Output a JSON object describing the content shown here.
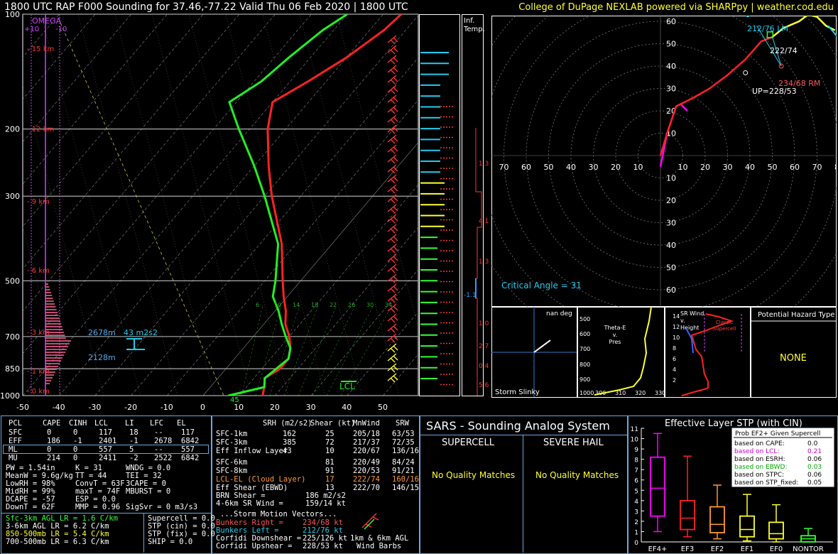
{
  "header": {
    "title": "1800 UTC RAP F000 Sounding for 37.46,-77.22 Valid  Thu 06 Feb 2020 | 1800 UTC",
    "credit": "College of DuPage NEXLAB powered via SHARPpy | weather.cod.edu"
  },
  "skewt": {
    "pressure_labels": [
      "100",
      "200",
      "300",
      "500",
      "700",
      "850",
      "1000"
    ],
    "temp_labels": [
      "-50",
      "-40",
      "-30",
      "-20",
      "-10",
      "0",
      "10",
      "20",
      "30",
      "40",
      "50"
    ],
    "height_labels": [
      "15 km",
      "12 km",
      "9 km",
      "6 km",
      "3 km",
      "1 km",
      "0 km"
    ],
    "omega_label": "OMEGA",
    "omega_plus": "+10",
    "omega_minus": "-10",
    "ann_2678": "2678m",
    "ann_2128": "2128m",
    "ann_srh": "43 m2s2",
    "lcl": "LCL",
    "sfc_td": "45",
    "wetbulb_labels": [
      "6",
      "10",
      "14",
      "18",
      "22",
      "26",
      "30",
      "34"
    ]
  },
  "infl": {
    "title1": "Inf.",
    "title2": "Temp.",
    "values": [
      "1.3",
      "4.1",
      "1.3",
      "-1.1",
      "1.0",
      "2.7",
      "0.4",
      "5.6"
    ]
  },
  "hodo": {
    "x_labels": [
      "70",
      "60",
      "50",
      "40",
      "30",
      "20",
      "10",
      "10",
      "20",
      "30",
      "40",
      "50",
      "60",
      "70",
      "80"
    ],
    "y_labels": [
      "60",
      "50",
      "40",
      "30",
      "20",
      "10",
      "10",
      "20",
      "30",
      "40",
      "50",
      "60"
    ],
    "lm": "212/76 LM",
    "mean": "222/74",
    "rm": "234/68 RM",
    "up": "UP=228/53",
    "critical": "Critical Angle = 31"
  },
  "small": {
    "slinky_title": "nan deg",
    "slinky_label": "Storm Slinky",
    "thetae_title": "Theta-E\nv.\nPres",
    "thetae_y": [
      "500",
      "600",
      "700",
      "800",
      "900",
      "1000"
    ],
    "thetae_x": [
      "300",
      "310",
      "320",
      "330"
    ],
    "srwind_title": "SR Wind\nv.\nHeight",
    "srwind_y": [
      "14",
      "12",
      "10",
      "8",
      "6",
      "4",
      "2"
    ],
    "srwind_classic": "Classic\nSupercell",
    "hazard_title": "Potential Hazard Type",
    "hazard_value": "NONE"
  },
  "parcel_table": {
    "headers": [
      "PCL",
      "CAPE",
      "CINH",
      "LCL",
      "LI",
      "LFC",
      "EL"
    ],
    "rows": [
      [
        "SFC",
        "0",
        "0",
        "117",
        "18",
        "--",
        "117"
      ],
      [
        "EFF",
        "186",
        "-1",
        "2401",
        "-1",
        "2678",
        "6842"
      ],
      [
        "ML",
        "0",
        "0",
        "557",
        "5",
        "--",
        "557"
      ],
      [
        "MU",
        "214",
        "0",
        "2411",
        "-2",
        "2522",
        "6842"
      ]
    ]
  },
  "indices": [
    [
      "PW = 1.54in",
      "K = 31",
      "WNDG = 0.0"
    ],
    [
      "MeanW = 9.6g/kg",
      "TT = 44",
      "TEI = 32"
    ],
    [
      "LowRH = 98%",
      "ConvT = 63F",
      "3CAPE = 0"
    ],
    [
      "MidRH = 99%",
      "maxT = 74F",
      "MBURST = 0"
    ],
    [
      "DCAPE = -57",
      "ESP = 0.0",
      ""
    ],
    [
      "DownT = 62F",
      "MMP = 0.96",
      "SigSvr = 0 m3/s3"
    ]
  ],
  "lapse": [
    {
      "text": "Sfc-3km AGL LR = 1.6 C/km",
      "color": "#33ff33"
    },
    {
      "text": "3-6km AGL LR = 6.2 C/km",
      "color": "#ffffff"
    },
    {
      "text": "850-500mb LR = 5.4 C/km",
      "color": "#ffff33"
    },
    {
      "text": "700-500mb LR = 6.3 C/km",
      "color": "#ffffff"
    }
  ],
  "composite": [
    "Supercell = 0.0",
    "STP (cin) = 0.0",
    "STP (fix) = 0.0",
    "SHIP = 0.0"
  ],
  "kinematics": {
    "headers": [
      "SRH (m2/s2)",
      "Shear (kt)",
      "MnWind",
      "SRW"
    ],
    "rows": [
      {
        "label": "SFC-1km",
        "vals": [
          "162",
          "25",
          "205/18",
          "63/53"
        ],
        "color": "#ffffff"
      },
      {
        "label": "SFC-3km",
        "vals": [
          "385",
          "72",
          "217/37",
          "72/35"
        ],
        "color": "#ffffff"
      },
      {
        "label": "Eff Inflow Layer",
        "vals": [
          "43",
          "10",
          "220/67",
          "136/16"
        ],
        "color": "#ffffff"
      },
      {
        "label": "SFC-6km",
        "vals": [
          "81",
          "220/49",
          "84/24"
        ],
        "color": "#ffffff"
      },
      {
        "label": "SFC-8km",
        "vals": [
          "91",
          "220/53",
          "91/21"
        ],
        "color": "#ffffff"
      },
      {
        "label": "LCL-EL (Cloud Layer)",
        "vals": [
          "17",
          "222/74",
          "160/16"
        ],
        "color": "#ff9933"
      },
      {
        "label": "Eff Shear (EBWD)",
        "vals": [
          "13",
          "222/70",
          "146/15"
        ],
        "color": "#ffffff"
      }
    ],
    "brn_label": "BRN Shear =",
    "brn": "186 m2/s2",
    "sr46_label": "4-6km SR Wind =",
    "sr46": "159/14 kt",
    "smv": "...Storm Motion Vectors...",
    "br_label": "Bunkers Right =",
    "br": "234/68 kt",
    "bl_label": "Bunkers Left =",
    "bl": "212/76 kt",
    "cd_label": "Corfidi Downshear =",
    "cd": "225/126 kt",
    "cu_label": "Corfidi Upshear =",
    "cu": "228/53 kt",
    "barb_label1": "1km & 6km AGL",
    "barb_label2": "Wind Barbs"
  },
  "sars": {
    "title": "SARS - Sounding Analog System",
    "supercell": "SUPERCELL",
    "hail": "SEVERE HAIL",
    "nq1": "No Quality Matches",
    "nq2": "No Quality Matches"
  },
  "stp": {
    "title": "Effective Layer STP (with CIN)",
    "y_labels": [
      "11",
      "10",
      "9",
      "8",
      "7",
      "6",
      "5",
      "4",
      "3",
      "2",
      "1",
      "0"
    ],
    "x_labels": [
      "EF4+",
      "EF3",
      "EF2",
      "EF1",
      "EF0",
      "NONTOR"
    ],
    "prob_title": "Prob EF2+ Given Supercell",
    "prob_rows": [
      {
        "label": "based on CAPE:",
        "val": "0.0",
        "color": "#000000"
      },
      {
        "label": "based on LCL:",
        "val": "0.21",
        "color": "#cc00cc"
      },
      {
        "label": "based on ESRH:",
        "val": "0.06",
        "color": "#000000"
      },
      {
        "label": "based on EBWD:",
        "val": "0.03",
        "color": "#00aa00"
      },
      {
        "label": "based on STPC:",
        "val": "0.06",
        "color": "#000000"
      },
      {
        "label": "based on STP_fixed:",
        "val": "0.05",
        "color": "#000000"
      }
    ]
  },
  "chart_data": [
    {
      "type": "line",
      "title": "",
      "xlabel": "",
      "ylabel": "",
      "xlim": [
        -50,
        50
      ],
      "ylim": [
        1000,
        100
      ],
      "scale": "log-pressure",
      "series": [
        {
          "name": "",
          "color": "#ff2222",
          "points": [
            [
              1000,
              16.5
            ],
            [
              950,
              15
            ],
            [
              900,
              13
            ],
            [
              850,
              15
            ],
            [
              800,
              15
            ],
            [
              750,
              13
            ],
            [
              700,
              10
            ],
            [
              650,
              6
            ],
            [
              600,
              3
            ],
            [
              550,
              -1
            ],
            [
              500,
              -5
            ],
            [
              400,
              -14
            ],
            [
              300,
              -28
            ],
            [
              250,
              -36
            ],
            [
              200,
              -45
            ],
            [
              170,
              -50
            ],
            [
              150,
              -45
            ],
            [
              130,
              -40
            ],
            [
              110,
              -36
            ],
            [
              100,
              -35
            ]
          ]
        },
        {
          "name": "",
          "color": "#22ee22",
          "points": [
            [
              1000,
              7
            ],
            [
              950,
              15
            ],
            [
              900,
              13
            ],
            [
              850,
              14
            ],
            [
              800,
              15
            ],
            [
              750,
              13
            ],
            [
              700,
              9
            ],
            [
              650,
              5
            ],
            [
              600,
              1
            ],
            [
              550,
              -4
            ],
            [
              500,
              -7
            ],
            [
              400,
              -15
            ],
            [
              300,
              -30
            ],
            [
              250,
              -40
            ],
            [
              200,
              -53
            ],
            [
              170,
              -62
            ],
            [
              150,
              -58
            ],
            [
              130,
              -56
            ],
            [
              110,
              -53
            ],
            [
              100,
              -50
            ]
          ]
        }
      ],
      "grid": true
    },
    {
      "type": "line",
      "title": "",
      "xlim": [
        -70,
        80
      ],
      "ylim": [
        -60,
        60
      ],
      "series": [
        {
          "name": "",
          "color": "#ff2222",
          "points": [
            [
              0,
              0
            ],
            [
              3,
              10
            ],
            [
              7,
              22
            ],
            [
              15,
              26
            ],
            [
              22,
              30
            ],
            [
              30,
              36
            ],
            [
              38,
              43
            ],
            [
              45,
              51
            ],
            [
              50,
              53
            ]
          ]
        },
        {
          "name": "",
          "color": "#ffff33",
          "points": [
            [
              50,
              53
            ],
            [
              55,
              57
            ],
            [
              62,
              60
            ],
            [
              66,
              63
            ],
            [
              70,
              62
            ],
            [
              74,
              58
            ],
            [
              78,
              56
            ]
          ]
        }
      ]
    },
    {
      "type": "bar",
      "title": "Effective Layer STP (with CIN)",
      "categories": [
        "EF4+",
        "EF3",
        "EF2",
        "EF1",
        "EF0",
        "NONTOR"
      ],
      "ylim": [
        0,
        11
      ],
      "boxes": [
        {
          "low": 1.0,
          "q1": 2.5,
          "median": 5.2,
          "q3": 8.2,
          "high": 10.5,
          "color": "#ff00ff"
        },
        {
          "low": 0.5,
          "q1": 1.2,
          "median": 2.3,
          "q3": 4.0,
          "high": 8.3,
          "color": "#ff2222"
        },
        {
          "low": 0.3,
          "q1": 0.9,
          "median": 1.7,
          "q3": 3.4,
          "high": 5.5,
          "color": "#ff9933"
        },
        {
          "low": 0.1,
          "q1": 0.5,
          "median": 1.2,
          "q3": 2.5,
          "high": 4.6,
          "color": "#ffff33"
        },
        {
          "low": 0.0,
          "q1": 0.3,
          "median": 0.8,
          "q3": 1.9,
          "high": 3.6,
          "color": "#ffff33"
        },
        {
          "low": 0.0,
          "q1": 0.0,
          "median": 0.3,
          "q3": 0.6,
          "high": 1.3,
          "color": "#33ff33"
        }
      ]
    }
  ]
}
